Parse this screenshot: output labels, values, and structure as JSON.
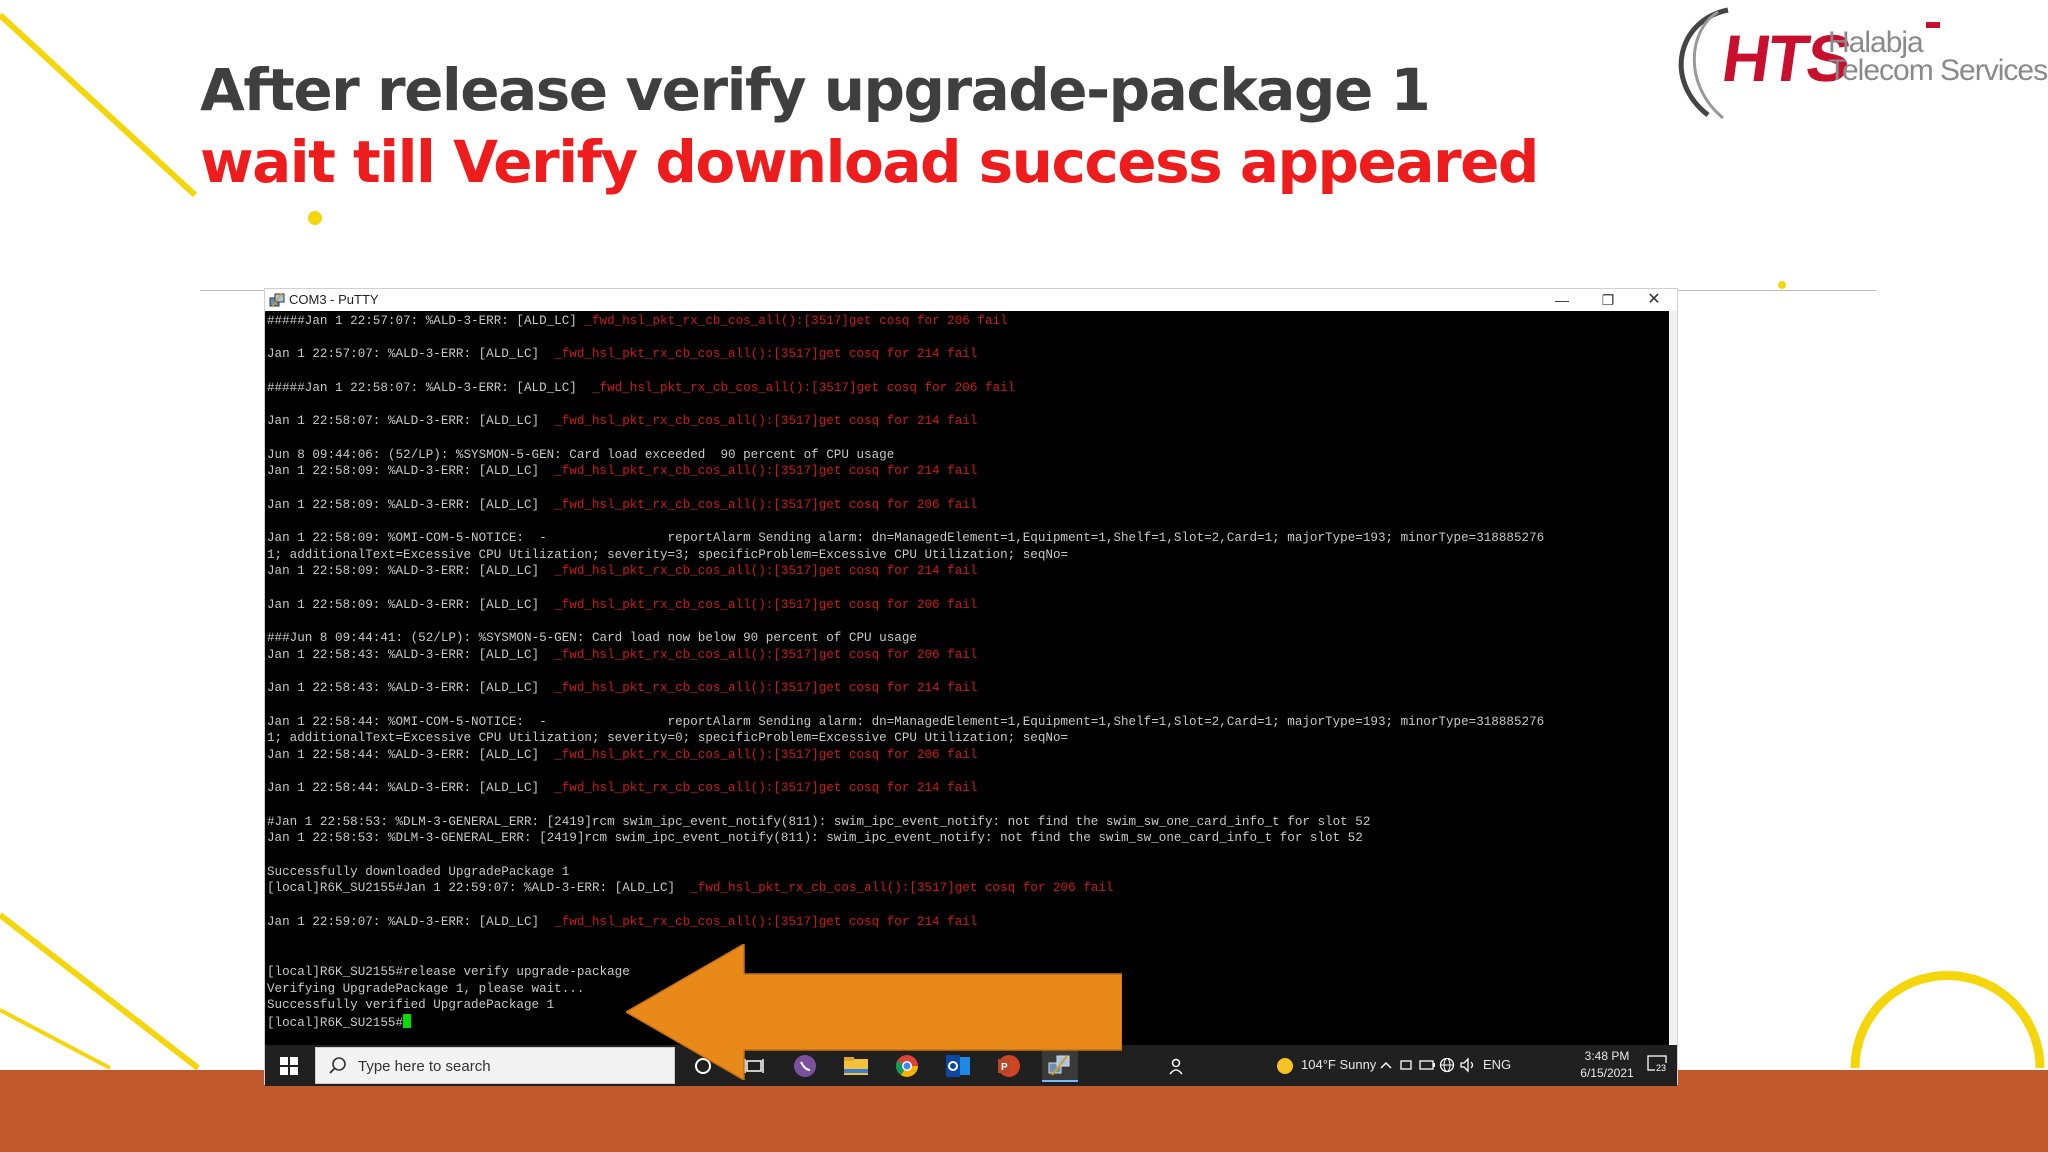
{
  "slide": {
    "title": "After release verify upgrade-package 1",
    "subtitle": "wait till Verify download success appeared",
    "logo": {
      "mark": "HTS",
      "line1": "Halabja",
      "line2": "Telecom Services"
    },
    "colors": {
      "title": "#3f3f3f",
      "subtitle": "#ee1c1c",
      "accent_yellow": "#f5d60a",
      "band": "#c0582c",
      "arrow": "#e8891a"
    }
  },
  "putty": {
    "window_title": "COM3 - PuTTY",
    "controls": {
      "minimize": "—",
      "maximize": "❐",
      "close": "✕"
    },
    "lines": [
      {
        "t": "#####Jan 1 22:57:07: %ALD-3-ERR: [ALD_LC] ",
        "e": "_fwd_hsl_pkt_rx_cb_cos_all():[3517]get cosq for 206 fail"
      },
      {
        "t": ""
      },
      {
        "t": "Jan 1 22:57:07: %ALD-3-ERR: [ALD_LC]  ",
        "e": "_fwd_hsl_pkt_rx_cb_cos_all():[3517]get cosq for 214 fail"
      },
      {
        "t": ""
      },
      {
        "t": "#####Jan 1 22:58:07: %ALD-3-ERR: [ALD_LC]  ",
        "e": "_fwd_hsl_pkt_rx_cb_cos_all():[3517]get cosq for 206 fail"
      },
      {
        "t": ""
      },
      {
        "t": "Jan 1 22:58:07: %ALD-3-ERR: [ALD_LC]  ",
        "e": "_fwd_hsl_pkt_rx_cb_cos_all():[3517]get cosq for 214 fail"
      },
      {
        "t": ""
      },
      {
        "t": "Jun 8 09:44:06: (52/LP): %SYSMON-5-GEN: Card load exceeded  90 percent of CPU usage"
      },
      {
        "t": "Jan 1 22:58:09: %ALD-3-ERR: [ALD_LC]  ",
        "e": "_fwd_hsl_pkt_rx_cb_cos_all():[3517]get cosq for 214 fail"
      },
      {
        "t": ""
      },
      {
        "t": "Jan 1 22:58:09: %ALD-3-ERR: [ALD_LC]  ",
        "e": "_fwd_hsl_pkt_rx_cb_cos_all():[3517]get cosq for 206 fail"
      },
      {
        "t": ""
      },
      {
        "t": "Jan 1 22:58:09: %OMI-COM-5-NOTICE:  -                reportAlarm Sending alarm: dn=ManagedElement=1,Equipment=1,Shelf=1,Slot=2,Card=1; majorType=193; minorType=318885276"
      },
      {
        "t": "1; additionalText=Excessive CPU Utilization; severity=3; specificProblem=Excessive CPU Utilization; seqNo="
      },
      {
        "t": "Jan 1 22:58:09: %ALD-3-ERR: [ALD_LC]  ",
        "e": "_fwd_hsl_pkt_rx_cb_cos_all():[3517]get cosq for 214 fail"
      },
      {
        "t": ""
      },
      {
        "t": "Jan 1 22:58:09: %ALD-3-ERR: [ALD_LC]  ",
        "e": "_fwd_hsl_pkt_rx_cb_cos_all():[3517]get cosq for 206 fail"
      },
      {
        "t": ""
      },
      {
        "t": "###Jun 8 09:44:41: (52/LP): %SYSMON-5-GEN: Card load now below 90 percent of CPU usage"
      },
      {
        "t": "Jan 1 22:58:43: %ALD-3-ERR: [ALD_LC]  ",
        "e": "_fwd_hsl_pkt_rx_cb_cos_all():[3517]get cosq for 206 fail"
      },
      {
        "t": ""
      },
      {
        "t": "Jan 1 22:58:43: %ALD-3-ERR: [ALD_LC]  ",
        "e": "_fwd_hsl_pkt_rx_cb_cos_all():[3517]get cosq for 214 fail"
      },
      {
        "t": ""
      },
      {
        "t": "Jan 1 22:58:44: %OMI-COM-5-NOTICE:  -                reportAlarm Sending alarm: dn=ManagedElement=1,Equipment=1,Shelf=1,Slot=2,Card=1; majorType=193; minorType=318885276"
      },
      {
        "t": "1; additionalText=Excessive CPU Utilization; severity=0; specificProblem=Excessive CPU Utilization; seqNo="
      },
      {
        "t": "Jan 1 22:58:44: %ALD-3-ERR: [ALD_LC]  ",
        "e": "_fwd_hsl_pkt_rx_cb_cos_all():[3517]get cosq for 206 fail"
      },
      {
        "t": ""
      },
      {
        "t": "Jan 1 22:58:44: %ALD-3-ERR: [ALD_LC]  ",
        "e": "_fwd_hsl_pkt_rx_cb_cos_all():[3517]get cosq for 214 fail"
      },
      {
        "t": ""
      },
      {
        "t": "#Jan 1 22:58:53: %DLM-3-GENERAL_ERR: [2419]rcm swim_ipc_event_notify(811): swim_ipc_event_notify: not find the swim_sw_one_card_info_t for slot 52"
      },
      {
        "t": "Jan 1 22:58:53: %DLM-3-GENERAL_ERR: [2419]rcm swim_ipc_event_notify(811): swim_ipc_event_notify: not find the swim_sw_one_card_info_t for slot 52"
      },
      {
        "t": ""
      },
      {
        "t": "Successfully downloaded UpgradePackage 1"
      },
      {
        "t": "[local]R6K_SU2155#Jan 1 22:59:07: %ALD-3-ERR: [ALD_LC]  ",
        "e": "_fwd_hsl_pkt_rx_cb_cos_all():[3517]get cosq for 206 fail"
      },
      {
        "t": ""
      },
      {
        "t": "Jan 1 22:59:07: %ALD-3-ERR: [ALD_LC]  ",
        "e": "_fwd_hsl_pkt_rx_cb_cos_all():[3517]get cosq for 214 fail"
      },
      {
        "t": ""
      },
      {
        "t": ""
      },
      {
        "t": "[local]R6K_SU2155#release verify upgrade-package"
      },
      {
        "t": "Verifying UpgradePackage 1, please wait..."
      },
      {
        "t": "Successfully verified UpgradePackage 1"
      },
      {
        "t": "[local]R6K_SU2155#",
        "cursor": true
      }
    ]
  },
  "taskbar": {
    "search_placeholder": "Type here to search",
    "weather": "104°F  Sunny",
    "lang": "ENG",
    "time": "3:48 PM",
    "date": "6/15/2021",
    "notifications": "23",
    "apps": [
      "task-view-icon",
      "viber-icon",
      "file-explorer-icon",
      "chrome-icon",
      "outlook-icon",
      "powerpoint-icon",
      "putty-icon"
    ]
  }
}
